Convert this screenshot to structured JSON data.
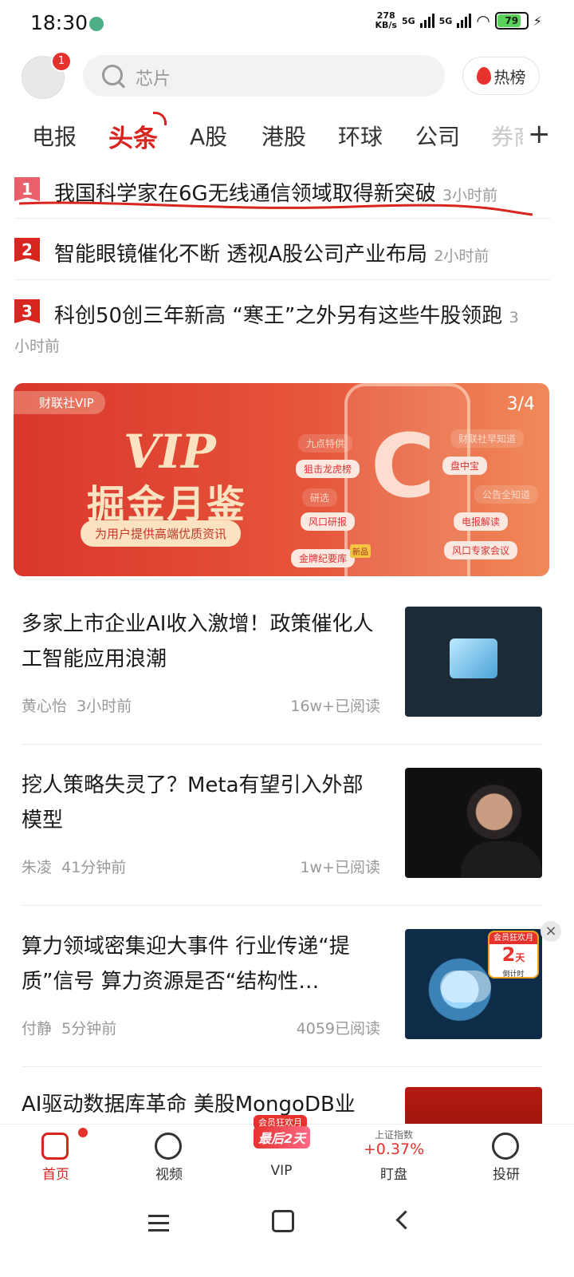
{
  "status_bar": {
    "time": "18:30",
    "net_speed": "278\nKB/s",
    "net_speed_top": "278",
    "net_speed_unit": "KB/s",
    "sim1": "5G",
    "sim2": "5G",
    "battery": "79"
  },
  "header": {
    "notification_count": "1",
    "search_placeholder": "芯片",
    "hot_button": "热榜"
  },
  "tabs": [
    "电报",
    "头条",
    "A股",
    "港股",
    "环球",
    "公司",
    "券商"
  ],
  "active_tab": "头条",
  "hot_list": [
    {
      "rank": "1",
      "title": "我国科学家在6G无线通信领域取得新突破",
      "time": "3小时前"
    },
    {
      "rank": "2",
      "title": "智能眼镜催化不断 透视A股公司产业布局",
      "time": "2小时前"
    },
    {
      "rank": "3",
      "title": "科创50创三年新高 “寒王”之外另有这些牛股领跑",
      "time": "3",
      "time_cont": "小时前"
    }
  ],
  "banner": {
    "brand": "财联社VIP",
    "headline": "VIP",
    "subheadline": "掘金月鉴",
    "pill": "为用户提供高端优质资讯",
    "counter": "3/4",
    "chips": [
      "九点特供",
      "狙击龙虎榜",
      "研选",
      "风口研报",
      "金牌纪要库",
      "财联社早知道",
      "盘中宝",
      "公告全知道",
      "电报解读",
      "风口专家会议"
    ]
  },
  "articles": [
    {
      "title": "多家上市企业AI收入激增！政策催化人工智能应用浪潮",
      "author": "黄心怡",
      "time": "3小时前",
      "reads": "16w+已阅读"
    },
    {
      "title": "挖人策略失灵了？Meta有望引入外部模型",
      "author": "朱凌",
      "time": "41分钟前",
      "reads": "1w+已阅读"
    },
    {
      "title": "算力领域密集迎大事件 行业传递“提质”信号 算力资源是否“结构性…",
      "author": "付静",
      "time": "5分钟前",
      "reads": "4059已阅读"
    },
    {
      "title": "AI驱动数据库革命 美股MongoDB业",
      "author": "",
      "time": "",
      "reads": ""
    }
  ],
  "promo": {
    "header": "会员狂欢月",
    "number": "2",
    "unit": "天",
    "footer": "倒计时"
  },
  "bottom_nav": {
    "home": "首页",
    "video": "视频",
    "vip": "VIP",
    "vip_badge_top": "会员狂欢月",
    "vip_badge_main": "最后2天",
    "index_name": "上证指数",
    "index_value": "+0.37%",
    "watch": "盯盘",
    "research": "投研"
  },
  "colors": {
    "accent": "#d8251f",
    "rank_badge": "#d8251f",
    "banner_start": "#d9362c",
    "banner_end": "#f08a5a",
    "index_up": "#e6322d"
  }
}
